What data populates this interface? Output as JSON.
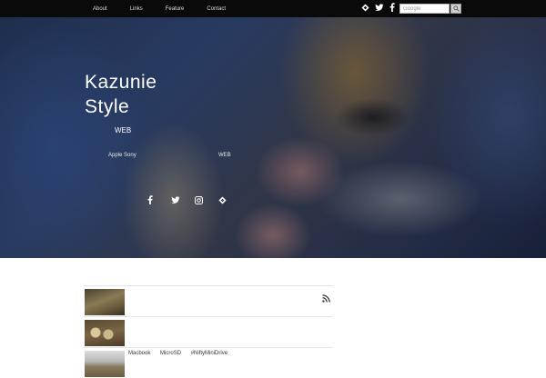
{
  "nav": {
    "items": [
      {
        "label": "About"
      },
      {
        "label": "Links"
      },
      {
        "label": "Feature"
      },
      {
        "label": "Contact"
      }
    ]
  },
  "search": {
    "placeholder": "Google"
  },
  "hero": {
    "title_line1": "Kazunie",
    "title_line2": "Style",
    "tagline": "WEB",
    "desc_left": "Apple Sony",
    "desc_right": "WEB"
  },
  "posts": [
    {
      "tags": []
    },
    {
      "tags": []
    },
    {
      "tags": [
        "Macbook",
        "MicroSD",
        "#NiftyMiniDrive"
      ]
    }
  ],
  "colors": {
    "topbar": "#0a0a0a",
    "nav_text": "#dddddd",
    "title_text": "#ffffff"
  },
  "icons": [
    "feedly-icon",
    "twitter-icon",
    "facebook-icon",
    "search-icon",
    "instagram-icon",
    "rss-icon"
  ]
}
